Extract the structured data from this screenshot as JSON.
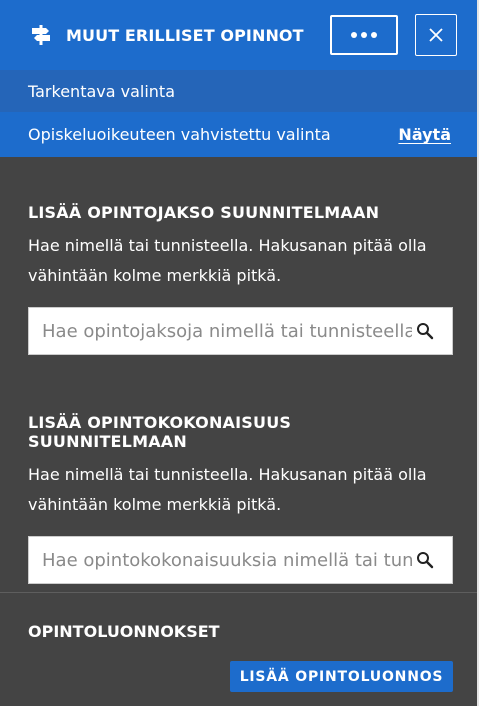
{
  "header": {
    "title": "MUUT ERILLISET OPINNOT",
    "logo_icon": "signpost-icon",
    "more_icon": "ellipsis-icon",
    "close_icon": "close-icon"
  },
  "refine": {
    "label": "Tarkentava valinta"
  },
  "study_right": {
    "label": "Opiskeluoikeuteen vahvistettu valinta",
    "show_link": "Näytä"
  },
  "course_search": {
    "heading": "LISÄÄ OPINTOJAKSO SUUNNITELMAAN",
    "help": "Hae nimellä tai tunnisteella. Hakusanan pitää olla vähintään kolme merkkiä pitkä.",
    "placeholder": "Hae opintojaksoja nimellä tai tunnisteella",
    "icon": "search-icon"
  },
  "module_search": {
    "heading": "LISÄÄ OPINTOKOKONAISUUS SUUNNITELMAAN",
    "help": "Hae nimellä tai tunnisteella. Hakusanan pitää olla vähintään kolme merkkiä pitkä.",
    "placeholder": "Hae opintokokonaisuuksia nimellä tai tunnisteella",
    "icon": "search-icon"
  },
  "drafts": {
    "heading": "OPINTOLUONNOKSET",
    "add_button": "LISÄÄ OPINTOLUONNOS"
  },
  "colors": {
    "header_blue": "#1d6ccc",
    "refine_blue": "#2565b8",
    "panel_bg": "#444444"
  }
}
